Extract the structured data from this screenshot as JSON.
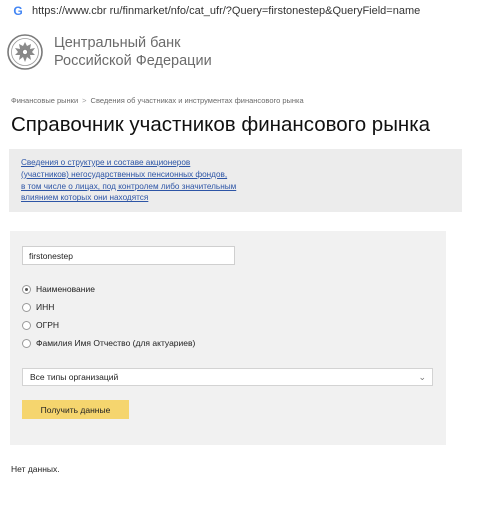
{
  "browser": {
    "url": "https://www.cbr ru/finmarket/nfo/cat_ufr/?Query=firstonestep&QueryField=name",
    "site_icon": "google-g-icon"
  },
  "header": {
    "bank_name_line1": "Центральный банк",
    "bank_name_line2": "Российской Федерации",
    "logo": "cbr-eagle-emblem-icon"
  },
  "breadcrumb": {
    "item1": "Финансовые рынки",
    "separator": ">",
    "item2": "Сведения об участниках и инструментах финансового рынка"
  },
  "page": {
    "title": "Справочник участников финансового рынка"
  },
  "info": {
    "link_text": "Сведения о структуре и составе акционеров\n(участников) негосударственных пенсионных фондов,\nв том числе о лицах, под контролем либо значительным\nвлиянием которых они находятся"
  },
  "form": {
    "query_value": "firstonestep",
    "radios": {
      "name": "Наименование",
      "inn": "ИНН",
      "ogrn": "ОГРН",
      "fio": "Фамилия Имя Отчество (для актуариев)"
    },
    "selected_radio": "name",
    "select_value": "Все типы организаций",
    "submit_label": "Получить данные"
  },
  "result": {
    "message": "Нет данных."
  },
  "colors": {
    "accent_button": "#f5d56e",
    "link": "#2d55a6",
    "info_background": "#ececec",
    "form_background": "#f1f1f1"
  }
}
